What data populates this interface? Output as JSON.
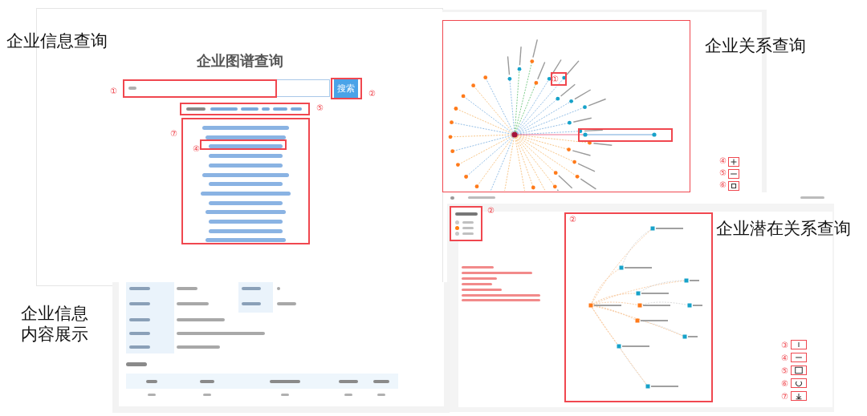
{
  "captions": [
    {
      "lines": [
        "企业信息查询"
      ]
    },
    {
      "lines": [
        "企业关系查询"
      ]
    },
    {
      "lines": [
        "企业潜在关系查询"
      ]
    },
    {
      "lines": [
        "企业信息",
        "内容展示"
      ]
    }
  ],
  "search_page": {
    "title": "企业图谱查询",
    "button": "搜索",
    "callouts": [
      "①",
      "②",
      "⑤",
      "⑦",
      "④"
    ]
  },
  "relation_graph": {
    "callouts": [
      "①",
      "④",
      "⑤",
      "⑥"
    ]
  },
  "potential_graph": {
    "legend": [
      {
        "color": "#c8c8c8"
      },
      {
        "color": "#ff7f0e"
      },
      {
        "color": "#c8c8c8"
      }
    ],
    "callouts": [
      "②",
      "②",
      "③",
      "④",
      "⑤",
      "⑥",
      "⑦"
    ]
  }
}
